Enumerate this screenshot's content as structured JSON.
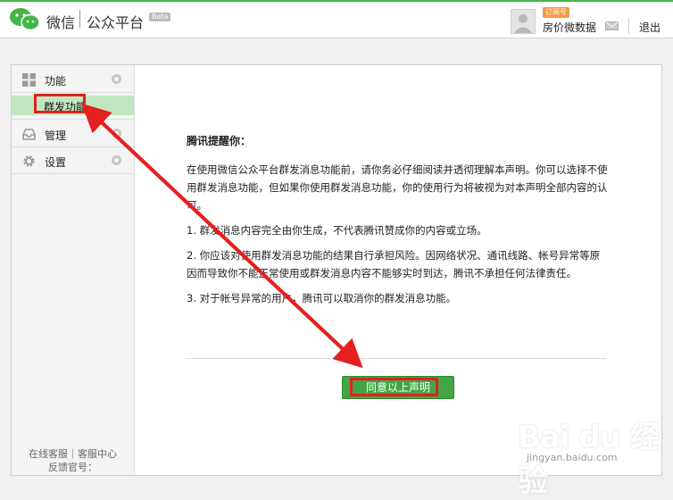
{
  "header": {
    "brand_wechat": "微信",
    "brand_platform": "公众平台",
    "beta": "Beta",
    "subscription_badge": "订阅号",
    "account_name": "房价微数据",
    "logout": "退出"
  },
  "sidebar": {
    "function_label": "功能",
    "mass_send_label": "群发功能",
    "manage_label": "管理",
    "settings_label": "设置",
    "footer_line1": "在线客服｜客服中心",
    "footer_line2": "反馈官号："
  },
  "content": {
    "title": "腾讯提醒你：",
    "para1": "在使用微信公众平台群发消息功能前，请你务必仔细阅读并透彻理解本声明。你可以选择不使用群发消息功能，但如果你使用群发消息功能，你的使用行为将被视为对本声明全部内容的认可。",
    "para2": "1. 群发消息内容完全由你生成，不代表腾讯赞成你的内容或立场。",
    "para3": "2. 你应该对使用群发消息功能的结果自行承担风险。因网络状况、通讯线路、帐号异常等原因而导致你不能正常使用或群发消息内容不能够实时到达，腾讯不承担任何法律责任。",
    "para4": "3. 对于帐号异常的用户，腾讯可以取消你的群发消息功能。",
    "agree_button": "同意以上声明"
  },
  "watermark": {
    "main": "Bai du 经验",
    "sub": "jingyan.baidu.com"
  },
  "colors": {
    "accent": "#44b549",
    "button": "#44a544",
    "highlight": "#e02020",
    "active_menu": "#c2e7bf"
  }
}
